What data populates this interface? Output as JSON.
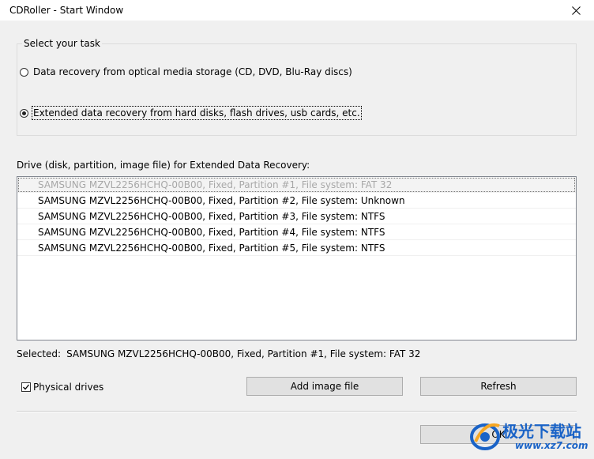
{
  "window": {
    "title": "CDRoller - Start Window",
    "close_icon": "close-icon"
  },
  "task_group": {
    "title": "Select your task",
    "options": [
      {
        "label": "Data recovery from optical media storage (CD, DVD, Blu-Ray discs)",
        "checked": false
      },
      {
        "label": "Extended data recovery from hard disks, flash drives, usb cards, etc.",
        "checked": true
      }
    ]
  },
  "drives": {
    "label": "Drive (disk, partition, image file) for Extended Data Recovery:",
    "items": [
      "SAMSUNG MZVL2256HCHQ-00B00, Fixed, Partition #1, File system: FAT 32",
      "SAMSUNG MZVL2256HCHQ-00B00, Fixed, Partition #2, File system: Unknown",
      "SAMSUNG MZVL2256HCHQ-00B00, Fixed, Partition #3, File system: NTFS",
      "SAMSUNG MZVL2256HCHQ-00B00, Fixed, Partition #4, File system: NTFS",
      "SAMSUNG MZVL2256HCHQ-00B00, Fixed, Partition #5, File system: NTFS"
    ],
    "selected_index": 0
  },
  "selected": {
    "label": "Selected:",
    "value": "SAMSUNG MZVL2256HCHQ-00B00, Fixed, Partition #1, File system: FAT 32"
  },
  "physical_drives": {
    "label": "Physical drives",
    "checked": true
  },
  "buttons": {
    "add_image": "Add image file",
    "refresh": "Refresh",
    "ok": "OK"
  },
  "watermark": {
    "text_cn": "极光下载站",
    "url": "www.xz7.com"
  }
}
